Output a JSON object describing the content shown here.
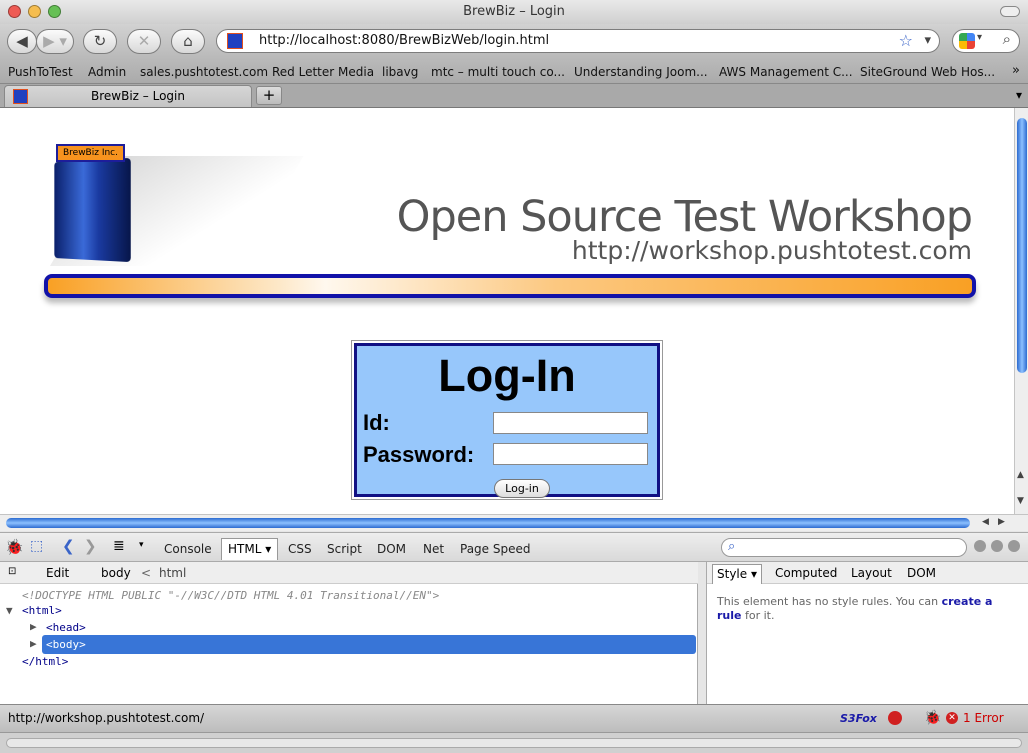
{
  "window": {
    "title": "BrewBiz – Login"
  },
  "toolbar": {
    "url": "http://localhost:8080/BrewBizWeb/login.html",
    "back_icon": "back-arrow-icon",
    "forward_icon": "forward-arrow-icon",
    "reload_icon": "reload-icon",
    "stop_icon": "stop-icon",
    "home_icon": "home-icon"
  },
  "bookmarks": [
    "PushToTest",
    "Admin",
    "sales.pushtotest.com",
    "Red Letter Media",
    "libavg",
    "mtc – multi touch co...",
    "Understanding Joom...",
    "AWS Management C...",
    "SiteGround Web Hos..."
  ],
  "tab": {
    "label": "BrewBiz – Login",
    "new_tab": "+"
  },
  "page": {
    "logo_text": "BrewBiz Inc.",
    "hero_title": "Open Source Test Workshop",
    "hero_url": "http://workshop.pushtotest.com",
    "login": {
      "heading": "Log-In",
      "id_label": "Id:",
      "password_label": "Password:",
      "id_value": "",
      "password_value": "",
      "button": "Log-in"
    }
  },
  "firebug": {
    "tabs": [
      "Console",
      "HTML",
      "CSS",
      "Script",
      "DOM",
      "Net",
      "Page Speed"
    ],
    "active_tab": "HTML",
    "edit": "Edit",
    "crumbs": [
      "body",
      "<",
      "html"
    ],
    "tree": {
      "doctype": "<!DOCTYPE HTML PUBLIC \"-//W3C//DTD HTML 4.01 Transitional//EN\">",
      "html_open": "<html>",
      "head": "<head>",
      "body": "<body>",
      "html_close": "</html>"
    },
    "side_tabs": [
      "Style",
      "Computed",
      "Layout",
      "DOM"
    ],
    "style_msg_prefix": "This element has no style rules. You can",
    "style_link": "create a rule",
    "style_msg_suffix": "for it."
  },
  "status": {
    "url": "http://workshop.pushtotest.com/",
    "s3fox": "S3Fox",
    "error_count": "1 Error"
  },
  "colors": {
    "accent": "#3875d7",
    "login_bg": "#97c7fb",
    "banner_orange": "#f9a024"
  }
}
